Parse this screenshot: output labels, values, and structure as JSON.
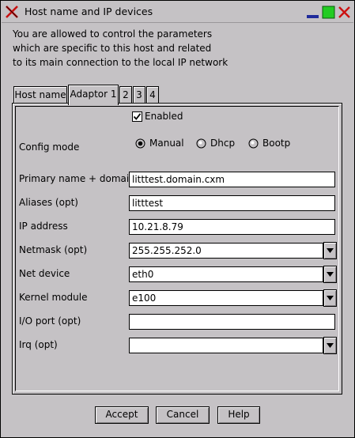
{
  "window": {
    "title": "Host name and IP devices"
  },
  "intro": {
    "lines": [
      "You are allowed to control the parameters",
      "which are specific to this host and related",
      "to its main connection to the local IP network"
    ]
  },
  "tabs": [
    {
      "label": "Host name",
      "active": false
    },
    {
      "label": "Adaptor 1",
      "active": true
    },
    {
      "label": "2",
      "active": false
    },
    {
      "label": "3",
      "active": false
    },
    {
      "label": "4",
      "active": false
    }
  ],
  "form": {
    "enabled_label": "Enabled",
    "enabled": true,
    "config_mode": {
      "label": "Config mode",
      "options": [
        "Manual",
        "Dhcp",
        "Bootp"
      ],
      "selected": "Manual"
    },
    "primary_name": {
      "label": "Primary name + domain",
      "value": "litttest.domain.cxm"
    },
    "aliases": {
      "label": "Aliases (opt)",
      "value": "litttest"
    },
    "ip_address": {
      "label": "IP address",
      "value": "10.21.8.79"
    },
    "netmask": {
      "label": "Netmask (opt)",
      "value": "255.255.252.0"
    },
    "net_device": {
      "label": "Net device",
      "value": "eth0"
    },
    "kernel_module": {
      "label": "Kernel module",
      "value": "e100"
    },
    "io_port": {
      "label": "I/O port (opt)",
      "value": ""
    },
    "irq": {
      "label": "Irq (opt)",
      "value": ""
    }
  },
  "buttons": {
    "accept": "Accept",
    "cancel": "Cancel",
    "help": "Help"
  },
  "icons": {
    "close": "close-icon",
    "minimize": "minimize-icon",
    "maximize": "maximize-icon",
    "app": "x-logo-icon"
  },
  "colors": {
    "background": "#c5c2c5",
    "minimize": "#1f2a9a",
    "maximize": "#22cc22",
    "close": "#cc1111"
  }
}
